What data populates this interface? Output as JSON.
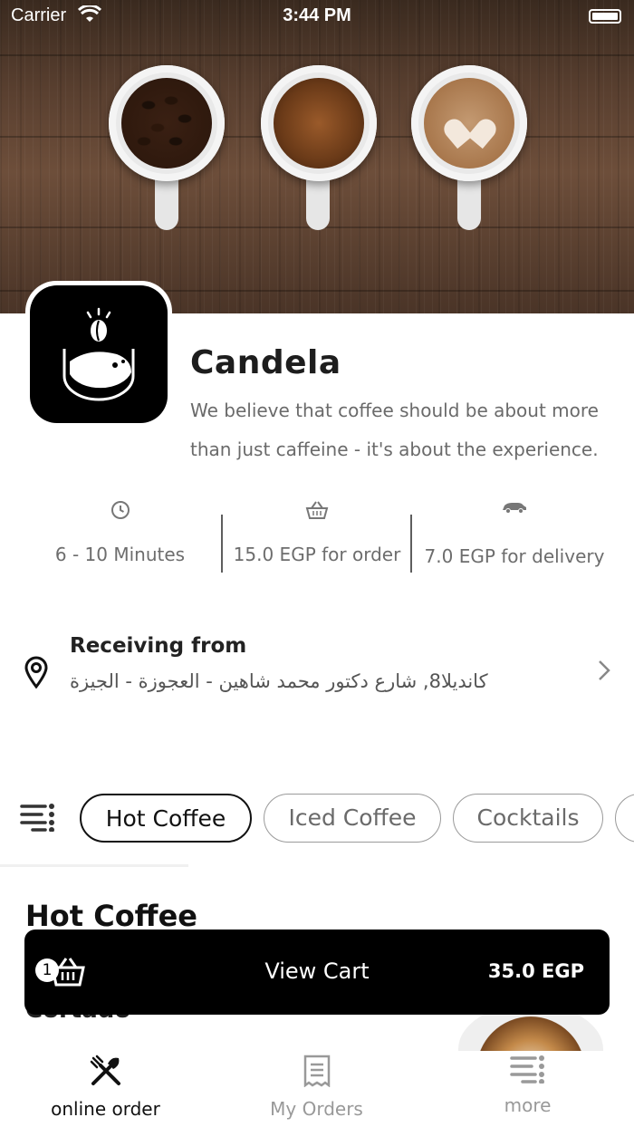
{
  "status_bar": {
    "carrier": "Carrier",
    "time": "3:44 PM"
  },
  "store": {
    "name": "Candela",
    "description": "We believe that coffee should be about more than just caffeine - it's about the experience."
  },
  "metrics": [
    {
      "icon": "clock-icon",
      "text": "6 - 10 Minutes"
    },
    {
      "icon": "basket-icon",
      "text": "15.0 EGP for order"
    },
    {
      "icon": "car-icon",
      "text": "7.0 EGP for delivery"
    }
  ],
  "receiving": {
    "title": "Receiving from",
    "address": "كانديلا8, شارع دكتور محمد شاهين - العجوزة - الجيزة"
  },
  "categories": [
    {
      "label": "Hot Coffee",
      "active": true
    },
    {
      "label": "Iced Coffee",
      "active": false
    },
    {
      "label": "Cocktails",
      "active": false
    }
  ],
  "menu": {
    "section_title": "Hot Coffee",
    "first_item": "Cortado"
  },
  "cart": {
    "count": "1",
    "label": "View Cart",
    "total": "35.0 EGP"
  },
  "bottom_nav": [
    {
      "label": "online order",
      "icon": "fork-knife-icon",
      "active": true
    },
    {
      "label": "My Orders",
      "icon": "receipt-icon",
      "active": false
    },
    {
      "label": "more",
      "icon": "menu-icon",
      "active": false
    }
  ],
  "colors": {
    "accent": "#000000",
    "muted_text": "#6a6a6a",
    "inactive_nav": "#999999"
  }
}
